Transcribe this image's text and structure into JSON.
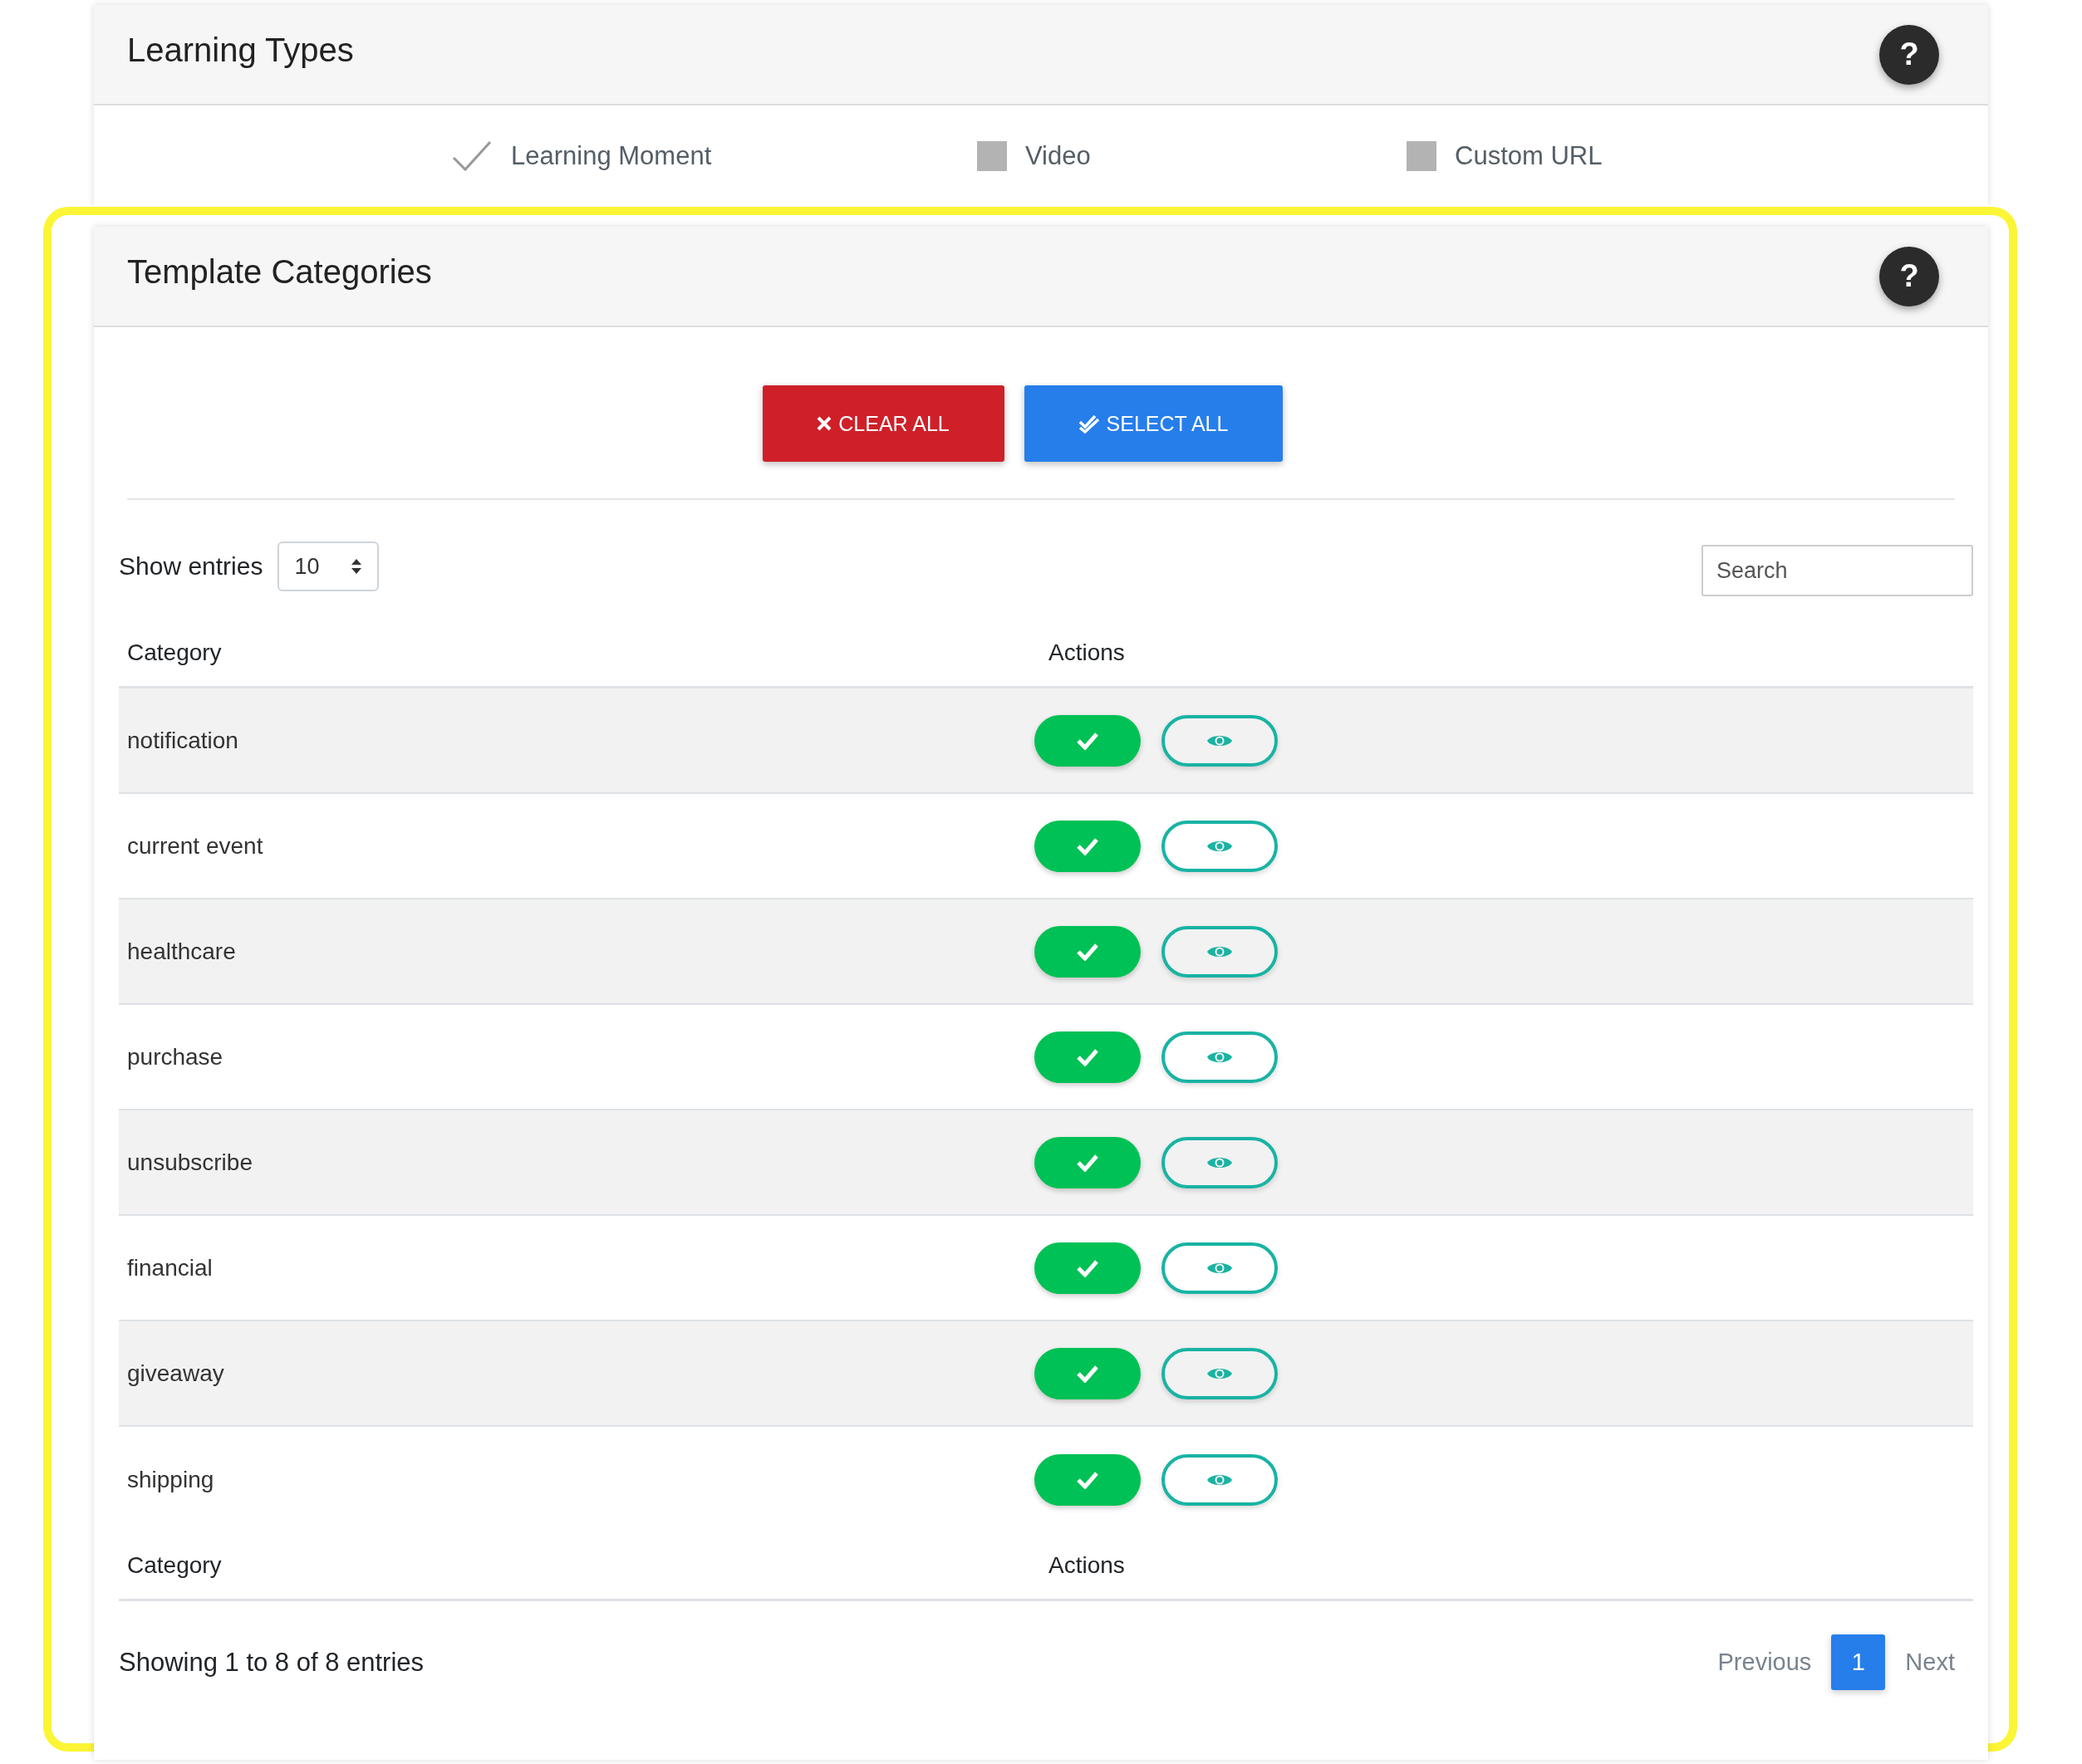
{
  "learning_types": {
    "title": "Learning Types",
    "help": "?",
    "options": [
      {
        "label": "Learning Moment",
        "checked": true
      },
      {
        "label": "Video",
        "checked": false
      },
      {
        "label": "Custom URL",
        "checked": false
      }
    ]
  },
  "template_categories": {
    "title": "Template Categories",
    "help": "?",
    "highlighted": true,
    "clear_all": "CLEAR ALL",
    "select_all": "SELECT ALL",
    "show_entries": {
      "label": "Show entries",
      "value": "10"
    },
    "search": {
      "placeholder": "Search"
    },
    "columns": [
      "Category",
      "Actions"
    ],
    "rows": [
      {
        "category": "notification"
      },
      {
        "category": "current event"
      },
      {
        "category": "healthcare"
      },
      {
        "category": "purchase"
      },
      {
        "category": "unsubscribe"
      },
      {
        "category": "financial"
      },
      {
        "category": "giveaway"
      },
      {
        "category": "shipping"
      }
    ],
    "footer_columns": [
      "Category",
      "Actions"
    ],
    "info": "Showing 1 to 8 of 8 entries",
    "pagination": {
      "previous": "Previous",
      "pages": [
        {
          "label": "1",
          "selected": true
        }
      ],
      "next": "Next"
    }
  }
}
